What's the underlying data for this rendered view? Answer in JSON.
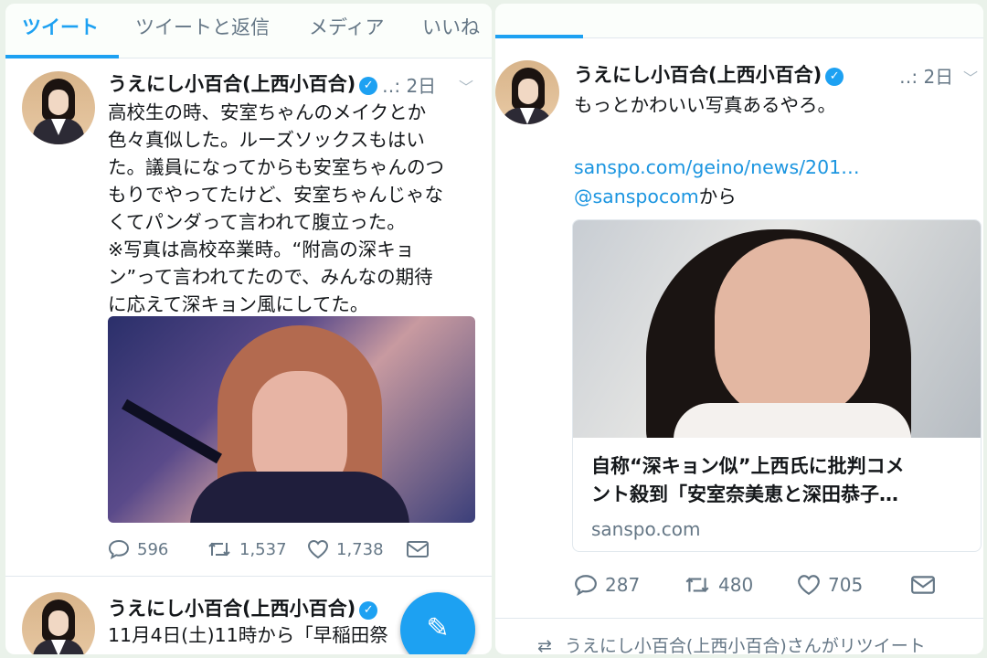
{
  "left": {
    "tabs": [
      "ツイート",
      "ツイートと返信",
      "メディア",
      "いいね"
    ],
    "tweet1": {
      "name": "うえにし小百合(上西小百合)",
      "time": "‥: 2日",
      "text": "高校生の時、安室ちゃんのメイクとか\n色々真似した。ルーズソックスもはい\nた。議員になってからも安室ちゃんのつ\nもりでやってたけど、安室ちゃんじゃな\nくてパンダって言われて腹立った。\n※写真は高校卒業時。“附高の深キョ\nン”って言われてたので、みんなの期待\nに応えて深キョン風にしてた。",
      "replies": "596",
      "retweets": "1,537",
      "likes": "1,738"
    },
    "tweet2": {
      "name": "うえにし小百合(上西小百合)",
      "text": "11月4日(土)11時から「早稲田祭"
    }
  },
  "right": {
    "tweet": {
      "name": "うえにし小百合(上西小百合)",
      "time": "‥: 2日",
      "text": "もっとかわいい写真あるやろ。",
      "link": "sanspo.com/geino/news/201…",
      "via_handle": "@sanspocom",
      "via_suffix": "から",
      "card_title_line1": "自称“深キョン似”上西氏に批判コメ",
      "card_title_line2": "ント殺到「安室奈美恵と深田恭子…",
      "card_domain": "sanspo.com",
      "replies": "287",
      "retweets": "480",
      "likes": "705"
    },
    "retweeted_by": "うえにし小百合(上西小百合)さんがリツイート"
  },
  "colors": {
    "accent": "#1da1f2",
    "link": "#1b95e0",
    "muted": "#657786"
  },
  "icons": [
    "verified-icon",
    "chevron-down-icon",
    "reply-icon",
    "retweet-icon",
    "like-icon",
    "dm-icon",
    "compose-icon"
  ]
}
